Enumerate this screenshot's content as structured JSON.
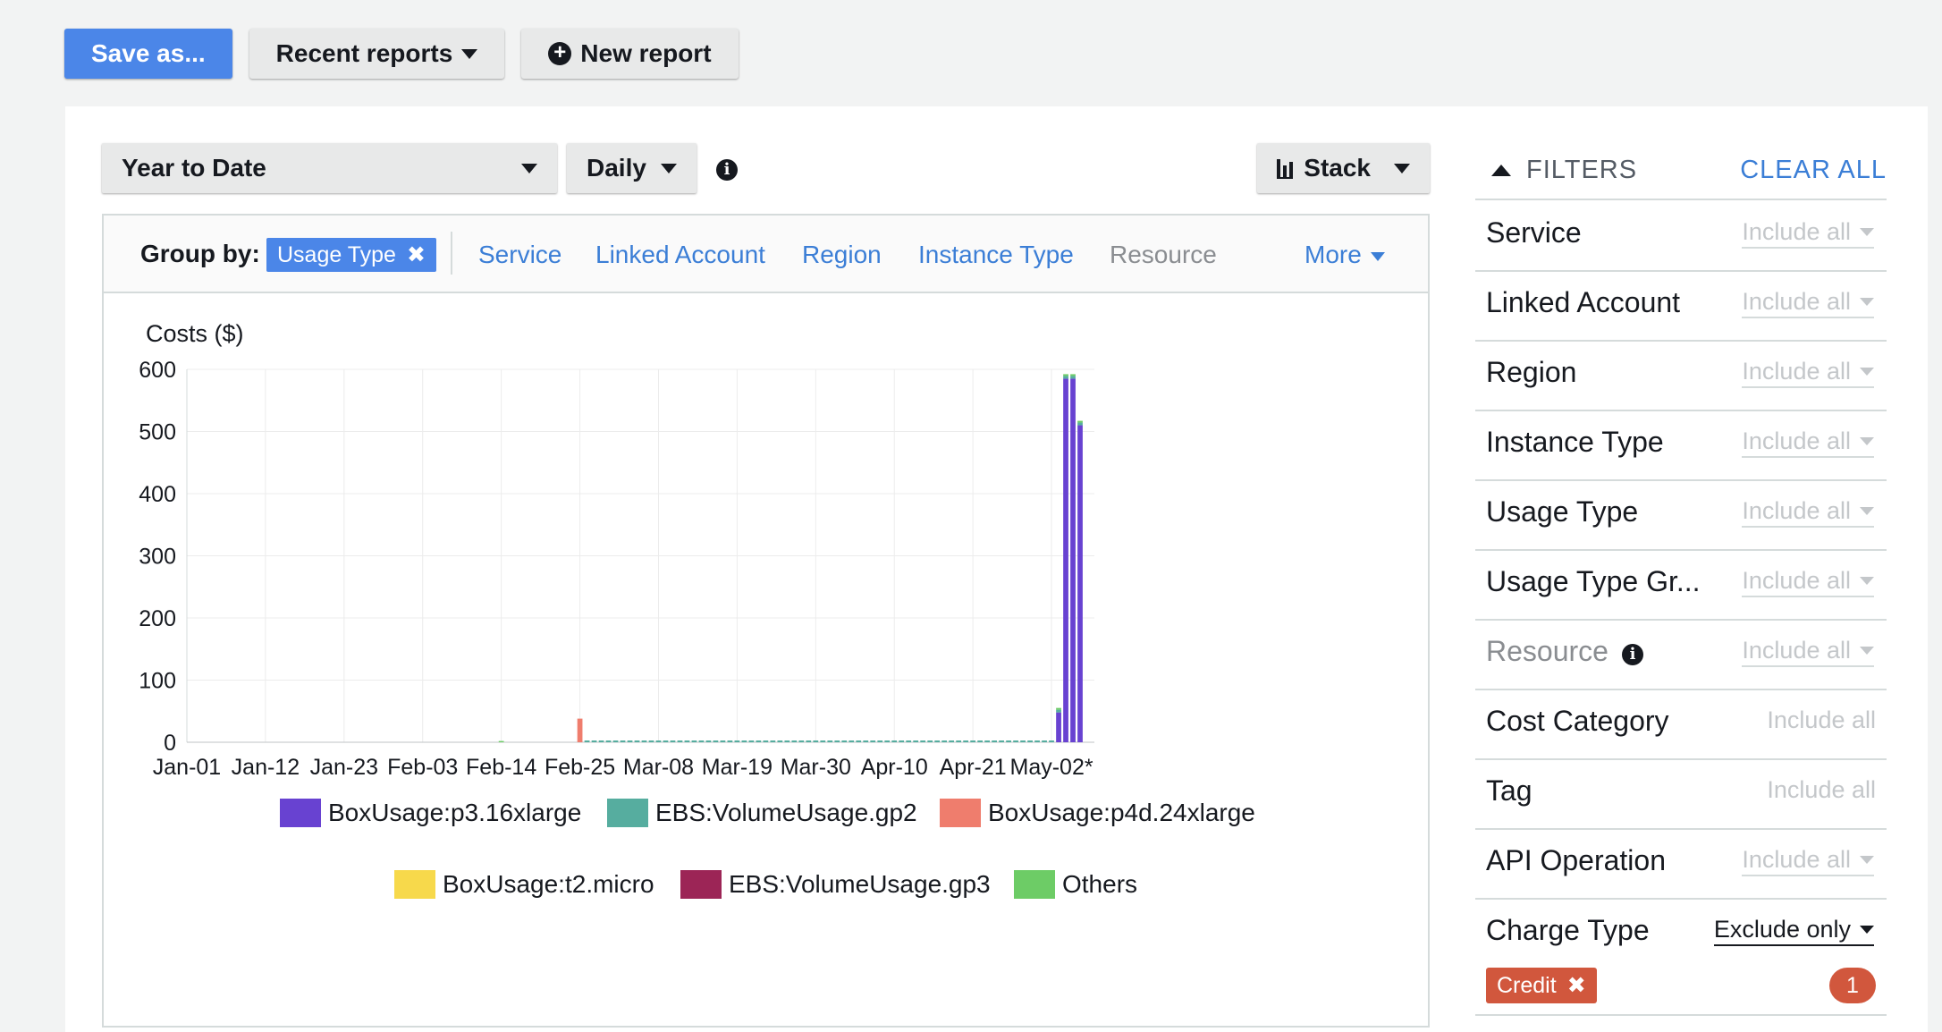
{
  "toolbar": {
    "save_label": "Save as...",
    "recent_label": "Recent reports",
    "new_label": "New report"
  },
  "controls": {
    "date_range": "Year to Date",
    "granularity": "Daily",
    "chart_style": "Stack"
  },
  "group_by": {
    "label": "Group by:",
    "selected": "Usage Type",
    "options": [
      "Service",
      "Linked Account",
      "Region",
      "Instance Type",
      "Resource"
    ],
    "more": "More"
  },
  "filters": {
    "title": "FILTERS",
    "clear_all": "CLEAR ALL",
    "rows": [
      {
        "name": "Service",
        "value": "Include all"
      },
      {
        "name": "Linked Account",
        "value": "Include all"
      },
      {
        "name": "Region",
        "value": "Include all"
      },
      {
        "name": "Instance Type",
        "value": "Include all"
      },
      {
        "name": "Usage Type",
        "value": "Include all"
      },
      {
        "name": "Usage Type Gr...",
        "value": "Include all"
      },
      {
        "name": "Resource",
        "value": "Include all"
      },
      {
        "name": "Cost Category",
        "value": "Include all"
      },
      {
        "name": "Tag",
        "value": "Include all"
      },
      {
        "name": "API Operation",
        "value": "Include all"
      },
      {
        "name": "Charge Type",
        "value": "Exclude only"
      }
    ],
    "charge_chip": "Credit",
    "charge_count": "1"
  },
  "colors": {
    "accent": "#4b86e8",
    "link": "#3b7ed6",
    "credit": "#d1573d"
  },
  "chart_data": {
    "type": "bar",
    "stacked": true,
    "ylabel": "Costs ($)",
    "ylim": [
      0,
      600
    ],
    "yticks": [
      0,
      100,
      200,
      300,
      400,
      500,
      600
    ],
    "xtick_labels": [
      "Jan-01",
      "Jan-12",
      "Jan-23",
      "Feb-03",
      "Feb-14",
      "Feb-25",
      "Mar-08",
      "Mar-19",
      "Mar-30",
      "Apr-10",
      "Apr-21",
      "May-02*"
    ],
    "grid": true,
    "legend_position": "bottom",
    "series": [
      {
        "name": "BoxUsage:p3.16xlarge",
        "color": "#6842d1"
      },
      {
        "name": "EBS:VolumeUsage.gp2",
        "color": "#56ad9f"
      },
      {
        "name": "BoxUsage:p4d.24xlarge",
        "color": "#ef7d6d"
      },
      {
        "name": "BoxUsage:t2.micro",
        "color": "#f7d94b"
      },
      {
        "name": "EBS:VolumeUsage.gp3",
        "color": "#9c2556"
      },
      {
        "name": "Others",
        "color": "#6dcc66"
      }
    ],
    "notable_bars": [
      {
        "day": "Feb-14",
        "series": "Others",
        "value": 2
      },
      {
        "day": "Feb-25",
        "series": "BoxUsage:p4d.24xlarge",
        "value": 38
      },
      {
        "day": "May-03",
        "series": "BoxUsage:p3.16xlarge",
        "value": 48
      },
      {
        "day": "May-04",
        "series": "BoxUsage:p3.16xlarge",
        "value": 585
      },
      {
        "day": "May-05",
        "series": "BoxUsage:p3.16xlarge",
        "value": 585
      },
      {
        "day": "May-06",
        "series": "BoxUsage:p3.16xlarge",
        "value": 510
      }
    ],
    "baseline": {
      "series": "EBS:VolumeUsage.gp2",
      "value": 1.5,
      "from": "Feb-26",
      "to": "May-02"
    }
  }
}
